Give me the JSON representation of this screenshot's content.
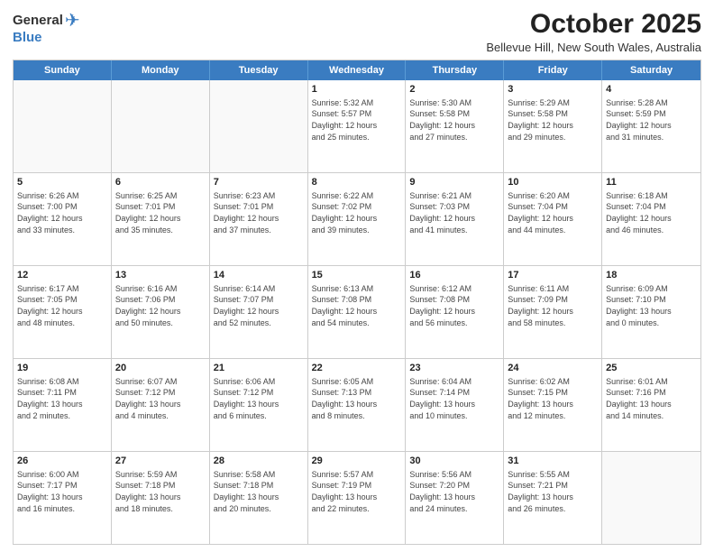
{
  "logo": {
    "general": "General",
    "blue": "Blue"
  },
  "header": {
    "month": "October 2025",
    "location": "Bellevue Hill, New South Wales, Australia"
  },
  "days": [
    "Sunday",
    "Monday",
    "Tuesday",
    "Wednesday",
    "Thursday",
    "Friday",
    "Saturday"
  ],
  "weeks": [
    [
      {
        "day": "",
        "info": ""
      },
      {
        "day": "",
        "info": ""
      },
      {
        "day": "",
        "info": ""
      },
      {
        "day": "1",
        "info": "Sunrise: 5:32 AM\nSunset: 5:57 PM\nDaylight: 12 hours\nand 25 minutes."
      },
      {
        "day": "2",
        "info": "Sunrise: 5:30 AM\nSunset: 5:58 PM\nDaylight: 12 hours\nand 27 minutes."
      },
      {
        "day": "3",
        "info": "Sunrise: 5:29 AM\nSunset: 5:58 PM\nDaylight: 12 hours\nand 29 minutes."
      },
      {
        "day": "4",
        "info": "Sunrise: 5:28 AM\nSunset: 5:59 PM\nDaylight: 12 hours\nand 31 minutes."
      }
    ],
    [
      {
        "day": "5",
        "info": "Sunrise: 6:26 AM\nSunset: 7:00 PM\nDaylight: 12 hours\nand 33 minutes."
      },
      {
        "day": "6",
        "info": "Sunrise: 6:25 AM\nSunset: 7:01 PM\nDaylight: 12 hours\nand 35 minutes."
      },
      {
        "day": "7",
        "info": "Sunrise: 6:23 AM\nSunset: 7:01 PM\nDaylight: 12 hours\nand 37 minutes."
      },
      {
        "day": "8",
        "info": "Sunrise: 6:22 AM\nSunset: 7:02 PM\nDaylight: 12 hours\nand 39 minutes."
      },
      {
        "day": "9",
        "info": "Sunrise: 6:21 AM\nSunset: 7:03 PM\nDaylight: 12 hours\nand 41 minutes."
      },
      {
        "day": "10",
        "info": "Sunrise: 6:20 AM\nSunset: 7:04 PM\nDaylight: 12 hours\nand 44 minutes."
      },
      {
        "day": "11",
        "info": "Sunrise: 6:18 AM\nSunset: 7:04 PM\nDaylight: 12 hours\nand 46 minutes."
      }
    ],
    [
      {
        "day": "12",
        "info": "Sunrise: 6:17 AM\nSunset: 7:05 PM\nDaylight: 12 hours\nand 48 minutes."
      },
      {
        "day": "13",
        "info": "Sunrise: 6:16 AM\nSunset: 7:06 PM\nDaylight: 12 hours\nand 50 minutes."
      },
      {
        "day": "14",
        "info": "Sunrise: 6:14 AM\nSunset: 7:07 PM\nDaylight: 12 hours\nand 52 minutes."
      },
      {
        "day": "15",
        "info": "Sunrise: 6:13 AM\nSunset: 7:08 PM\nDaylight: 12 hours\nand 54 minutes."
      },
      {
        "day": "16",
        "info": "Sunrise: 6:12 AM\nSunset: 7:08 PM\nDaylight: 12 hours\nand 56 minutes."
      },
      {
        "day": "17",
        "info": "Sunrise: 6:11 AM\nSunset: 7:09 PM\nDaylight: 12 hours\nand 58 minutes."
      },
      {
        "day": "18",
        "info": "Sunrise: 6:09 AM\nSunset: 7:10 PM\nDaylight: 13 hours\nand 0 minutes."
      }
    ],
    [
      {
        "day": "19",
        "info": "Sunrise: 6:08 AM\nSunset: 7:11 PM\nDaylight: 13 hours\nand 2 minutes."
      },
      {
        "day": "20",
        "info": "Sunrise: 6:07 AM\nSunset: 7:12 PM\nDaylight: 13 hours\nand 4 minutes."
      },
      {
        "day": "21",
        "info": "Sunrise: 6:06 AM\nSunset: 7:12 PM\nDaylight: 13 hours\nand 6 minutes."
      },
      {
        "day": "22",
        "info": "Sunrise: 6:05 AM\nSunset: 7:13 PM\nDaylight: 13 hours\nand 8 minutes."
      },
      {
        "day": "23",
        "info": "Sunrise: 6:04 AM\nSunset: 7:14 PM\nDaylight: 13 hours\nand 10 minutes."
      },
      {
        "day": "24",
        "info": "Sunrise: 6:02 AM\nSunset: 7:15 PM\nDaylight: 13 hours\nand 12 minutes."
      },
      {
        "day": "25",
        "info": "Sunrise: 6:01 AM\nSunset: 7:16 PM\nDaylight: 13 hours\nand 14 minutes."
      }
    ],
    [
      {
        "day": "26",
        "info": "Sunrise: 6:00 AM\nSunset: 7:17 PM\nDaylight: 13 hours\nand 16 minutes."
      },
      {
        "day": "27",
        "info": "Sunrise: 5:59 AM\nSunset: 7:18 PM\nDaylight: 13 hours\nand 18 minutes."
      },
      {
        "day": "28",
        "info": "Sunrise: 5:58 AM\nSunset: 7:18 PM\nDaylight: 13 hours\nand 20 minutes."
      },
      {
        "day": "29",
        "info": "Sunrise: 5:57 AM\nSunset: 7:19 PM\nDaylight: 13 hours\nand 22 minutes."
      },
      {
        "day": "30",
        "info": "Sunrise: 5:56 AM\nSunset: 7:20 PM\nDaylight: 13 hours\nand 24 minutes."
      },
      {
        "day": "31",
        "info": "Sunrise: 5:55 AM\nSunset: 7:21 PM\nDaylight: 13 hours\nand 26 minutes."
      },
      {
        "day": "",
        "info": ""
      }
    ]
  ]
}
